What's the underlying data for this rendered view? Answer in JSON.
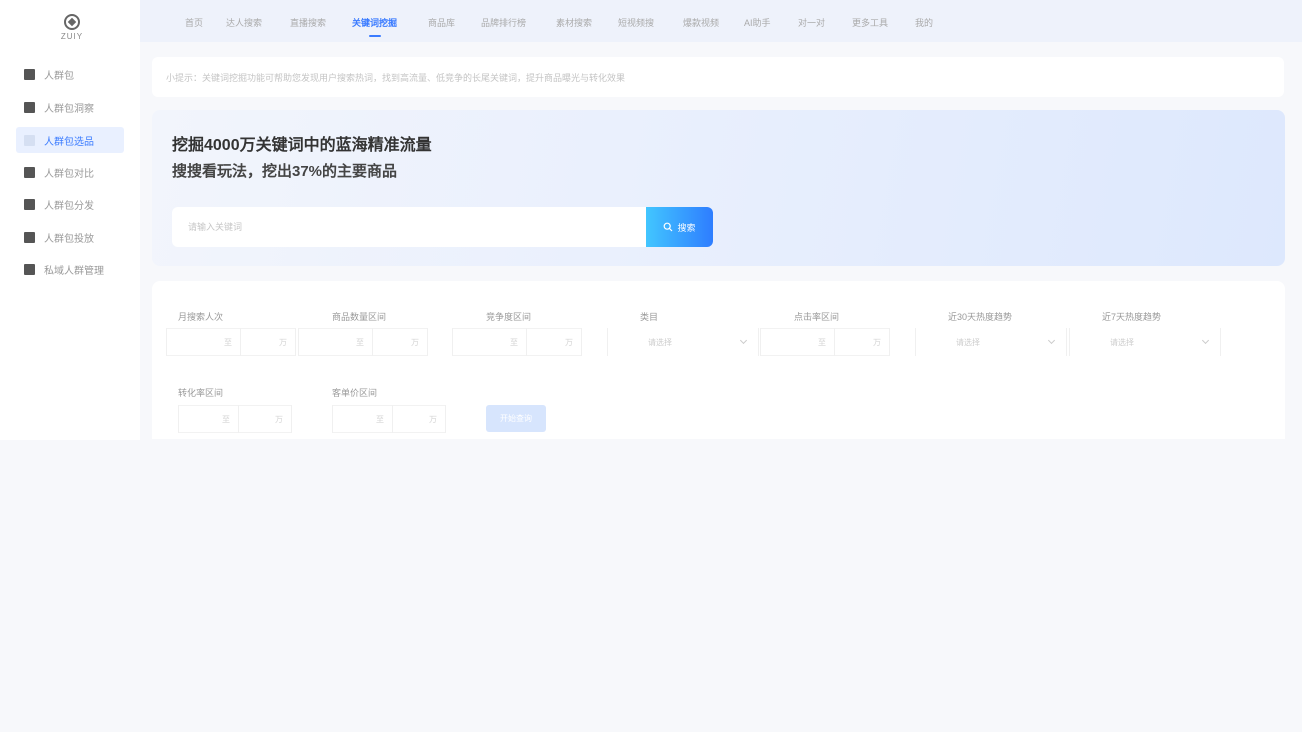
{
  "logo": {
    "text": "ZUIY",
    "icon": "logo-mark"
  },
  "sidebar": {
    "items": [
      {
        "label": "人群包",
        "active": false
      },
      {
        "label": "人群包洞察",
        "active": false
      },
      {
        "label": "人群包选品",
        "active": true
      },
      {
        "label": "人群包对比",
        "active": false
      },
      {
        "label": "人群包分发",
        "active": false
      },
      {
        "label": "人群包投放",
        "active": false
      },
      {
        "label": "私域人群管理",
        "active": false
      }
    ]
  },
  "topnav": {
    "items": [
      {
        "label": "首页",
        "active": false
      },
      {
        "label": "达人搜索",
        "active": false
      },
      {
        "label": "直播搜索",
        "active": false
      },
      {
        "label": "关键词挖掘",
        "active": true
      },
      {
        "label": "商品库",
        "active": false
      },
      {
        "label": "品牌排行榜",
        "active": false
      },
      {
        "label": "素材搜索",
        "active": false
      },
      {
        "label": "短视频搜",
        "active": false
      },
      {
        "label": "爆款视频",
        "active": false
      },
      {
        "label": "AI助手",
        "active": false
      },
      {
        "label": "对一对",
        "active": false
      },
      {
        "label": "更多工具",
        "active": false
      },
      {
        "label": "我的",
        "active": false
      }
    ]
  },
  "notice": {
    "text": "小提示：关键词挖掘功能可帮助您发现用户搜索热词，找到高流量、低竞争的长尾关键词，提升商品曝光与转化效果"
  },
  "hero": {
    "title_line1": "挖掘4000万关键词中的蓝海精准流量",
    "title_line2": "搜搜看玩法，挖出37%的主要商品",
    "search_placeholder": "请输入关键词",
    "search_button": "搜索",
    "accent_color": "#2e7dff"
  },
  "filters": {
    "row1": [
      {
        "label": "月搜索人次",
        "kind": "range",
        "from_label": "至",
        "to_label": "万"
      },
      {
        "label": "商品数量区间",
        "kind": "range",
        "from_label": "至",
        "to_label": "万"
      },
      {
        "label": "竞争度区间",
        "kind": "range",
        "from_label": "至",
        "to_label": "万"
      },
      {
        "label": "类目",
        "kind": "select",
        "placeholder": "请选择"
      },
      {
        "label": "点击率区间",
        "kind": "range",
        "from_label": "至",
        "to_label": "万"
      },
      {
        "label": "近30天热度趋势",
        "kind": "select",
        "placeholder": "请选择"
      },
      {
        "label": "近7天热度趋势",
        "kind": "select",
        "placeholder": "请选择"
      }
    ],
    "row2": [
      {
        "label": "转化率区间",
        "kind": "range",
        "from_label": "至",
        "to_label": "万"
      },
      {
        "label": "客单价区间",
        "kind": "range",
        "from_label": "至",
        "to_label": "万"
      }
    ],
    "query_button": "开始查询"
  }
}
